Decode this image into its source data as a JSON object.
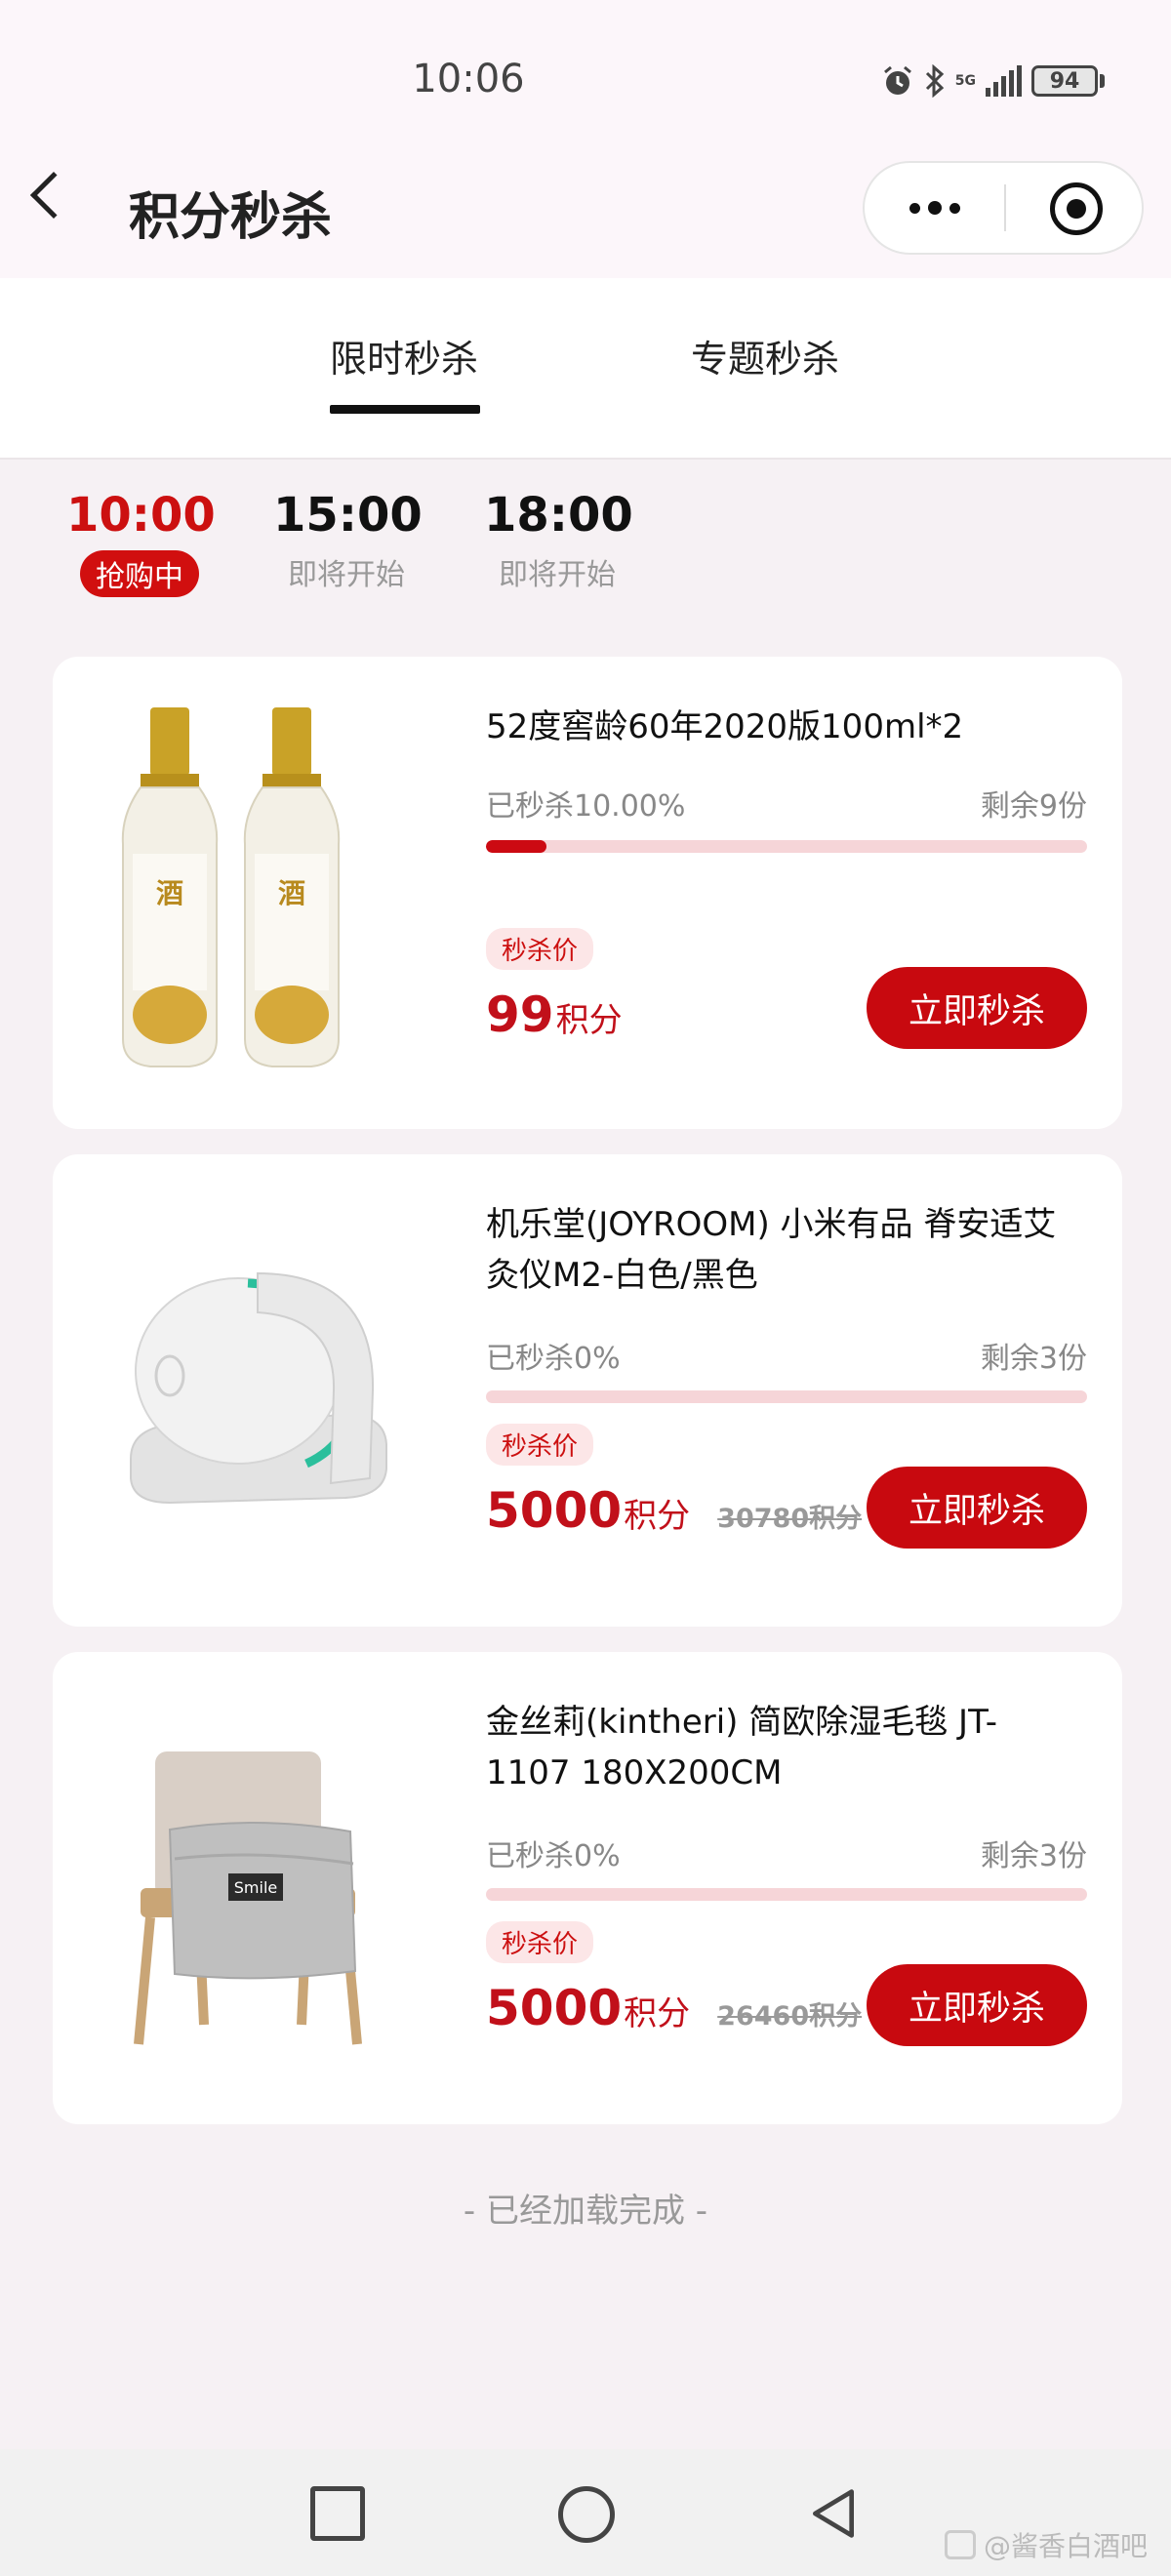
{
  "status_bar": {
    "time": "10:06",
    "network": "5G",
    "battery": "94"
  },
  "header": {
    "title": "积分秒杀"
  },
  "tabs": [
    {
      "label": "限时秒杀",
      "active": true
    },
    {
      "label": "专题秒杀",
      "active": false
    }
  ],
  "time_slots": [
    {
      "time": "10:00",
      "status": "抢购中",
      "active": true
    },
    {
      "time": "15:00",
      "status": "即将开始",
      "active": false
    },
    {
      "time": "18:00",
      "status": "即将开始",
      "active": false
    }
  ],
  "products": [
    {
      "name": "52度窖龄60年2020版100ml*2",
      "sold": "已秒杀10.00%",
      "sold_fraction": 0.1,
      "remaining": "剩余9份",
      "price_tag": "秒杀价",
      "price": "99",
      "unit": "积分",
      "original_price": "",
      "buy_label": "立即秒杀",
      "image_icon": "liquor-bottles-image"
    },
    {
      "name": "机乐堂(JOYROOM) 小米有品 脊安适艾灸仪M2-白色/黑色",
      "sold": "已秒杀0%",
      "sold_fraction": 0,
      "remaining": "剩余3份",
      "price_tag": "秒杀价",
      "price": "5000",
      "unit": "积分",
      "original_price": "30780积分",
      "buy_label": "立即秒杀",
      "image_icon": "moxibustion-device-image"
    },
    {
      "name": "金丝莉(kintheri) 简欧除湿毛毯 JT-1107 180X200CM",
      "sold": "已秒杀0%",
      "sold_fraction": 0,
      "remaining": "剩余3份",
      "price_tag": "秒杀价",
      "price": "5000",
      "unit": "积分",
      "original_price": "26460积分",
      "buy_label": "立即秒杀",
      "image_icon": "chair-blanket-image"
    }
  ],
  "footer_text": "- 已经加载完成 -",
  "watermark": "@酱香白酒吧",
  "colors": {
    "accent": "#c8090f",
    "bar_bg": "#f6d5d8",
    "tag_bg": "#fce6e7",
    "page_bg": "#f6f1f4"
  }
}
